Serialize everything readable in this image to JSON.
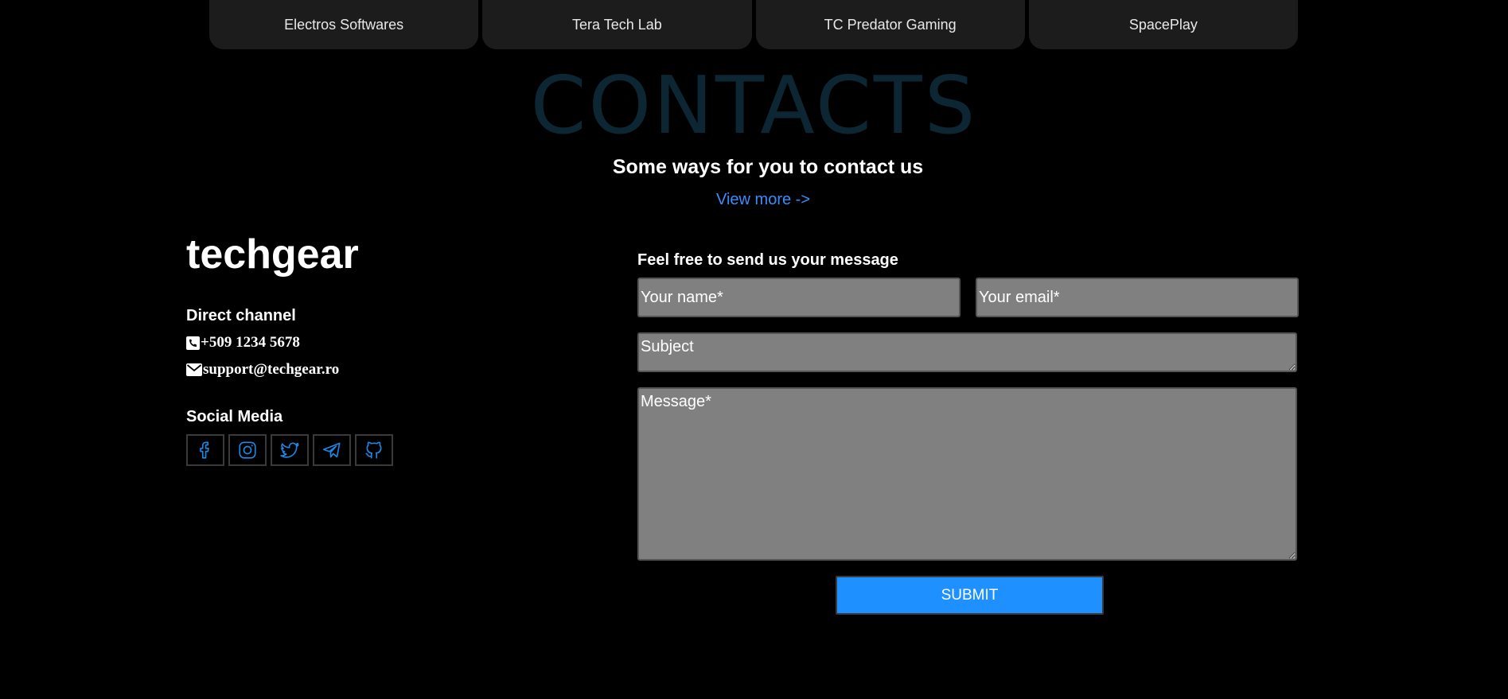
{
  "partners": [
    {
      "label": "Electros Softwares"
    },
    {
      "label": "Tera Tech Lab"
    },
    {
      "label": "TC Predator Gaming"
    },
    {
      "label": "SpacePlay"
    }
  ],
  "contacts": {
    "title": "CONTACTS",
    "subtitle": "Some ways for you to contact us",
    "view_more": "View more ->"
  },
  "brand": "techgear",
  "direct_channel": {
    "label": "Direct channel",
    "phone": "+509 1234 5678",
    "email": "support@techgear.ro"
  },
  "social_media": {
    "label": "Social Media",
    "icons": [
      "facebook-icon",
      "instagram-icon",
      "twitter-icon",
      "telegram-icon",
      "github-icon"
    ]
  },
  "form": {
    "title": "Feel free to send us your message",
    "name_placeholder": "Your name*",
    "email_placeholder": "Your email*",
    "subject_placeholder": "Subject",
    "message_placeholder": "Message*",
    "submit_label": "SUBMIT"
  },
  "colors": {
    "accent": "#1e90ff",
    "link": "#3b8cff",
    "icon": "#1e88e5",
    "field_bg": "#808080",
    "title_faded": "#0d2633"
  }
}
